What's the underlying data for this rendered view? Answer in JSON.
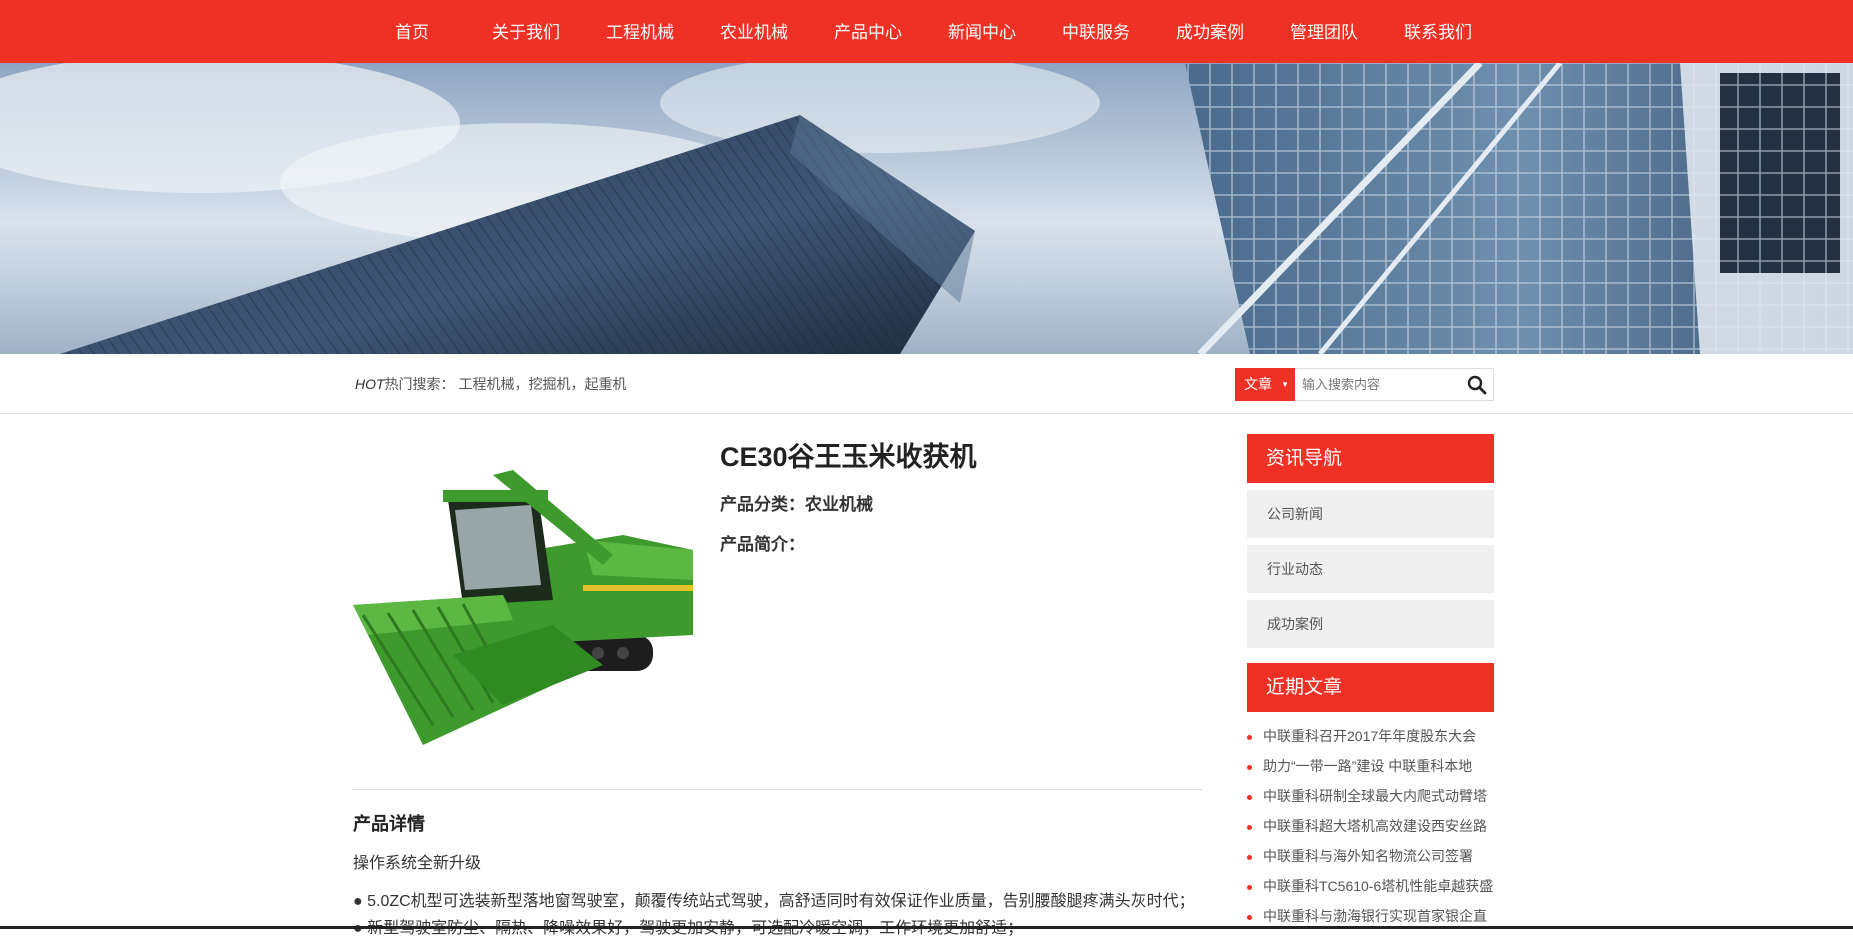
{
  "nav": {
    "items": [
      "首页",
      "关于我们",
      "工程机械",
      "农业机械",
      "产品中心",
      "新闻中心",
      "中联服务",
      "成功案例",
      "管理团队",
      "联系我们"
    ]
  },
  "search": {
    "hot_tag": "HOT",
    "hot_label": "热门搜索：",
    "hot_keywords": "工程机械，挖掘机，起重机",
    "category": "文章",
    "placeholder": "输入搜索内容"
  },
  "product": {
    "title": "CE30谷王玉米收获机",
    "category_label": "产品分类：",
    "category_value": "农业机械",
    "intro_label": "产品简介："
  },
  "details": {
    "title": "产品详情",
    "subtitle": "操作系统全新升级",
    "lines": [
      "● 5.0ZC机型可选装新型落地窗驾驶室，颠覆传统站式驾驶，高舒适同时有效保证作业质量，告别腰酸腿疼满头灰时代；",
      "● 新型驾驶室防尘、隔热、降噪效果好，驾驶更加安静，可选配冷暖空调，工作环境更加舒适；"
    ]
  },
  "sidebar": {
    "nav_title": "资讯导航",
    "nav_items": [
      "公司新闻",
      "行业动态",
      "成功案例"
    ],
    "recent_title": "近期文章",
    "recent_items": [
      "中联重科召开2017年年度股东大会",
      "助力“一带一路”建设 中联重科本地",
      "中联重科研制全球最大内爬式动臂塔",
      "中联重科超大塔机高效建设西安丝路",
      "中联重科与海外知名物流公司签署",
      "中联重科TC5610-6塔机性能卓越获盛",
      "中联重科与渤海银行实现首家银企直"
    ]
  },
  "colors": {
    "accent": "#ee3124",
    "harvester_green": "#3f9a2e"
  },
  "icons": {
    "search": "search-icon",
    "dropdown": "triangle-down-icon"
  }
}
